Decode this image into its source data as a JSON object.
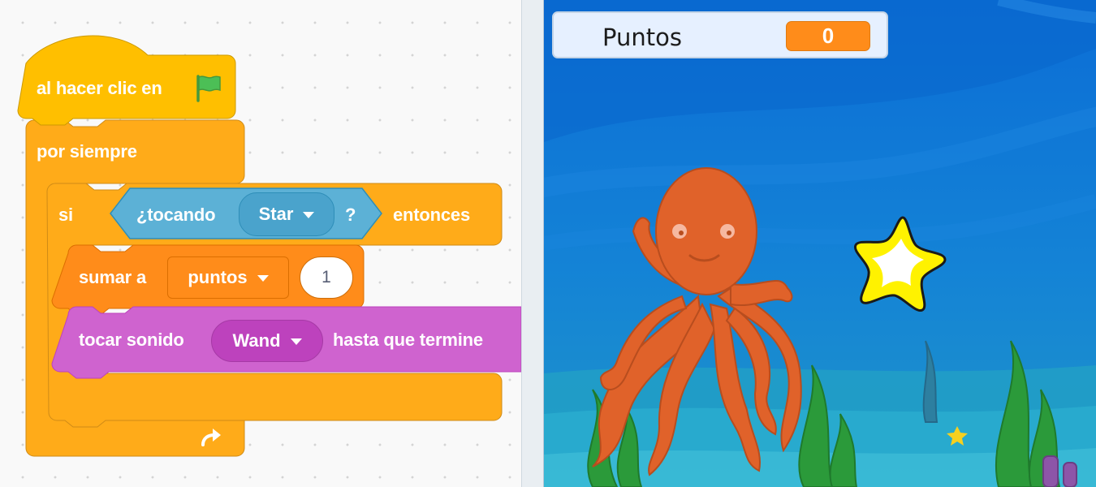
{
  "editor": {
    "hat": {
      "label": "al hacer clic en",
      "icon": "green-flag-icon"
    },
    "forever": {
      "label": "por siempre",
      "loop_icon": "loop-arrow-icon"
    },
    "if_block": {
      "label_if": "si",
      "label_then": "entonces",
      "condition": {
        "label": "¿tocando",
        "menu_value": "Star",
        "question": "?"
      }
    },
    "change_var": {
      "label": "sumar a",
      "variable": "puntos",
      "amount": "1"
    },
    "play_sound": {
      "label": "tocar sonido",
      "sound": "Wand",
      "suffix": "hasta que termine"
    }
  },
  "stage": {
    "monitor": {
      "label": "Puntos",
      "value": "0"
    },
    "sprites": [
      "octopus",
      "star"
    ]
  },
  "colors": {
    "events": "#ffbf00",
    "control": "#ffab19",
    "variables": "#ff8c1a",
    "sensing": "#5cb1d6",
    "sound": "#cf63cf",
    "stage_water": "#0f73d9"
  }
}
